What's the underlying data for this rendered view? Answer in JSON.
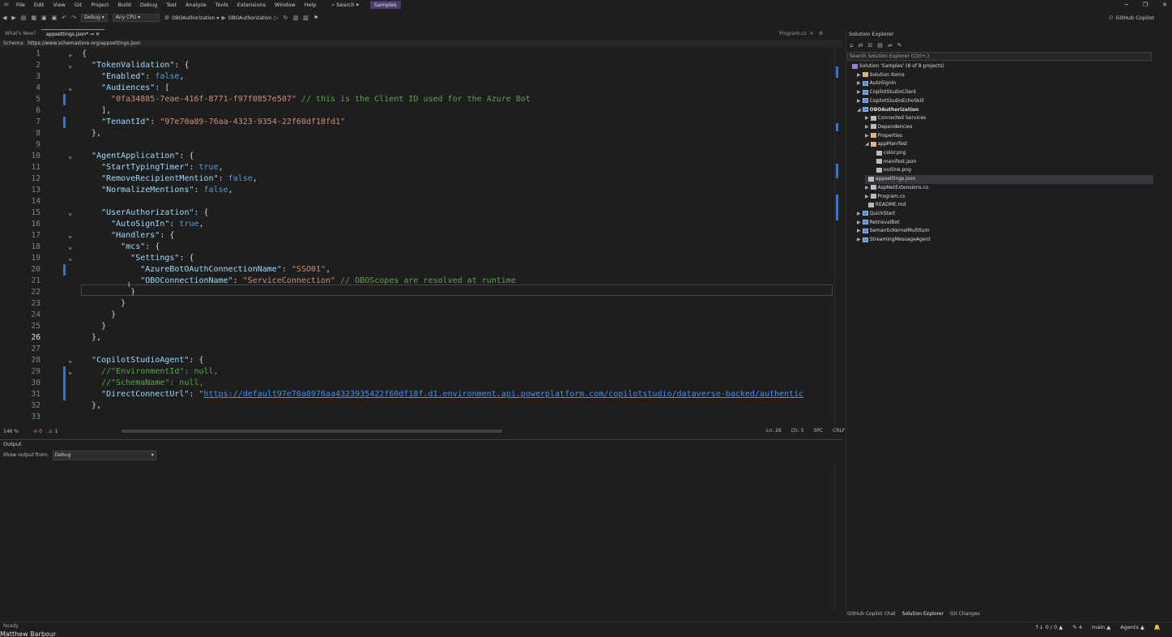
{
  "menu": [
    "File",
    "Edit",
    "View",
    "Git",
    "Project",
    "Build",
    "Debug",
    "Test",
    "Analyze",
    "Tools",
    "Extensions",
    "Window",
    "Help"
  ],
  "search_label": "Search",
  "solution_name": "Samples",
  "toolbar": {
    "config": "Debug",
    "platform": "Any CPU",
    "startup_project": "OBOAuthorization",
    "run_target": "OBOAuthorization",
    "github_copilot": "GitHub Copilot"
  },
  "tabs": {
    "whats_new": "What's New?",
    "active": "appsettings.json*",
    "program": "Program.cs"
  },
  "schema": {
    "label": "Schema:",
    "url": "https://www.schemastore.org/appsettings.json"
  },
  "code_lines": [
    {
      "n": "1",
      "fold": "v",
      "mark": false,
      "html": "<span class='p'>{</span>"
    },
    {
      "n": "2",
      "fold": "v",
      "mark": false,
      "html": "  <span class='k'>\"TokenValidation\"</span><span class='p'>: {</span>"
    },
    {
      "n": "3",
      "fold": "",
      "mark": false,
      "html": "    <span class='k'>\"Enabled\"</span><span class='p'>: </span><span class='b'>false</span><span class='p'>,</span>"
    },
    {
      "n": "4",
      "fold": "v",
      "mark": false,
      "html": "    <span class='k'>\"Audiences\"</span><span class='p'>: [</span>"
    },
    {
      "n": "5",
      "fold": "",
      "mark": true,
      "html": "      <span class='s'>\"0fa34885-7eae-416f-8771-f97f0857e507\"</span> <span class='c'>// this is the Client ID used for the Azure Bot</span>"
    },
    {
      "n": "6",
      "fold": "",
      "mark": false,
      "html": "    <span class='p'>],</span>"
    },
    {
      "n": "7",
      "fold": "",
      "mark": true,
      "html": "    <span class='k'>\"TenantId\"</span><span class='p'>: </span><span class='s'>\"97e70a89-76aa-4323-9354-22f60df18fd1\"</span>"
    },
    {
      "n": "8",
      "fold": "",
      "mark": false,
      "html": "  <span class='p'>},</span>"
    },
    {
      "n": "9",
      "fold": "",
      "mark": false,
      "html": ""
    },
    {
      "n": "10",
      "fold": "v",
      "mark": false,
      "html": "  <span class='k'>\"AgentApplication\"</span><span class='p'>: {</span>"
    },
    {
      "n": "11",
      "fold": "",
      "mark": false,
      "html": "    <span class='k'>\"StartTypingTimer\"</span><span class='p'>: </span><span class='b'>true</span><span class='p'>,</span>"
    },
    {
      "n": "12",
      "fold": "",
      "mark": false,
      "html": "    <span class='k'>\"RemoveRecipientMention\"</span><span class='p'>: </span><span class='b'>false</span><span class='p'>,</span>"
    },
    {
      "n": "13",
      "fold": "",
      "mark": false,
      "html": "    <span class='k'>\"NormalizeMentions\"</span><span class='p'>: </span><span class='b'>false</span><span class='p'>,</span>"
    },
    {
      "n": "14",
      "fold": "",
      "mark": false,
      "html": ""
    },
    {
      "n": "15",
      "fold": "v",
      "mark": false,
      "html": "    <span class='k'>\"UserAuthorization\"</span><span class='p'>: {</span>"
    },
    {
      "n": "16",
      "fold": "",
      "mark": false,
      "html": "      <span class='k'>\"AutoSignIn\"</span><span class='p'>: </span><span class='b'>true</span><span class='p'>,</span>"
    },
    {
      "n": "17",
      "fold": "v",
      "mark": false,
      "html": "      <span class='k'>\"Handlers\"</span><span class='p'>: {</span>"
    },
    {
      "n": "18",
      "fold": "v",
      "mark": false,
      "html": "        <span class='k'>\"mcs\"</span><span class='p'>: {</span>"
    },
    {
      "n": "19",
      "fold": "v",
      "mark": false,
      "html": "          <span class='k'>\"Settings\"</span><span class='p'>: {</span>"
    },
    {
      "n": "20",
      "fold": "",
      "mark": true,
      "html": "            <span class='k'>\"AzureBotOAuthConnectionName\"</span><span class='p'>: </span><span class='s'>\"SSO01\"</span><span class='p'>,</span>"
    },
    {
      "n": "21",
      "fold": "",
      "mark": false,
      "html": "            <span class='k'>\"OBOConnectionName\"</span><span class='p'>: </span><span class='s'>\"ServiceConnection\"</span> <span class='c'>// OBOScopes are resolved at runtime</span>"
    },
    {
      "n": "22",
      "fold": "",
      "mark": false,
      "html": "          <span class='p'>}</span>"
    },
    {
      "n": "23",
      "fold": "",
      "mark": false,
      "html": "        <span class='p'>}</span>"
    },
    {
      "n": "24",
      "fold": "",
      "mark": false,
      "html": "      <span class='p'>}</span>"
    },
    {
      "n": "25",
      "fold": "",
      "mark": false,
      "html": "    <span class='p'>}</span>"
    },
    {
      "n": "26",
      "fold": "",
      "mark": false,
      "html": "  <span class='p'>},</span>"
    },
    {
      "n": "27",
      "fold": "",
      "mark": false,
      "html": ""
    },
    {
      "n": "28",
      "fold": "v",
      "mark": false,
      "html": "  <span class='k'>\"CopilotStudioAgent\"</span><span class='p'>: {</span>"
    },
    {
      "n": "29",
      "fold": "v",
      "mark": true,
      "html": "    <span class='c'>//\"EnvironmentId\": null,</span>"
    },
    {
      "n": "30",
      "fold": "",
      "mark": true,
      "html": "    <span class='c'>//\"SchemaName\": null,</span>"
    },
    {
      "n": "31",
      "fold": "",
      "mark": true,
      "html": "    <span class='k'>\"DirectConnectUrl\"</span><span class='p'>: </span><span class='s'>\"</span><span class='lnk'>https://default97e70a8976aa4323935422f60df18f.d1.environment.api.powerplatform.com/copilotstudio/dataverse-backed/authentic</span>"
    },
    {
      "n": "32",
      "fold": "",
      "mark": false,
      "html": "  <span class='p'>},</span>"
    },
    {
      "n": "33",
      "fold": "",
      "mark": false,
      "html": ""
    }
  ],
  "current_line": "26",
  "editor_status": {
    "zoom": "146 %",
    "errors": "0",
    "warnings": "1",
    "line": "Ln: 26",
    "col": "Ch: 5",
    "spc": "SPC",
    "eol": "CRLF"
  },
  "output": {
    "title": "Output",
    "show_from_label": "Show output from:",
    "source": "Debug"
  },
  "solution_explorer": {
    "title": "Solution Explorer",
    "search_placeholder": "Search Solution Explorer (Ctrl+;)",
    "tree": [
      {
        "label": "Solution 'Samples' (8 of 8 projects)",
        "depth": 0,
        "icon": "sol",
        "arrow": ""
      },
      {
        "label": "Solution Items",
        "depth": 1,
        "icon": "folder",
        "arrow": "▶"
      },
      {
        "label": "AutoSignIn",
        "depth": 1,
        "icon": "proj",
        "arrow": "▶"
      },
      {
        "label": "CopilotStudioClient",
        "depth": 1,
        "icon": "proj",
        "arrow": "▶"
      },
      {
        "label": "CopilotStudioEchoSkill",
        "depth": 1,
        "icon": "proj",
        "arrow": "▶"
      },
      {
        "label": "OBOAuthorization",
        "depth": 1,
        "icon": "proj",
        "arrow": "◢",
        "bold": true
      },
      {
        "label": "Connected Services",
        "depth": 2,
        "icon": "file",
        "arrow": "▶"
      },
      {
        "label": "Dependencies",
        "depth": 2,
        "icon": "file",
        "arrow": "▶"
      },
      {
        "label": "Properties",
        "depth": 2,
        "icon": "folder",
        "arrow": "▶"
      },
      {
        "label": "appManifest",
        "depth": 2,
        "icon": "folder",
        "arrow": "◢"
      },
      {
        "label": "color.png",
        "depth": 3,
        "icon": "file",
        "arrow": ""
      },
      {
        "label": "manifest.json",
        "depth": 3,
        "icon": "file",
        "arrow": ""
      },
      {
        "label": "outline.png",
        "depth": 3,
        "icon": "file",
        "arrow": ""
      },
      {
        "label": "appsettings.json",
        "depth": 2,
        "icon": "file",
        "arrow": "",
        "sel": true
      },
      {
        "label": "AspNetExtensions.cs",
        "depth": 2,
        "icon": "file",
        "arrow": "▶"
      },
      {
        "label": "Program.cs",
        "depth": 2,
        "icon": "file",
        "arrow": "▶"
      },
      {
        "label": "README.md",
        "depth": 2,
        "icon": "file",
        "arrow": ""
      },
      {
        "label": "QuickStart",
        "depth": 1,
        "icon": "proj",
        "arrow": "▶"
      },
      {
        "label": "RetrievalBot",
        "depth": 1,
        "icon": "proj",
        "arrow": "▶"
      },
      {
        "label": "SemanticKernelMultiturn",
        "depth": 1,
        "icon": "proj",
        "arrow": "▶"
      },
      {
        "label": "StreamingMessageAgent",
        "depth": 1,
        "icon": "proj",
        "arrow": "▶"
      }
    ],
    "bottom_tabs": [
      "GitHub Copilot Chat",
      "Solution Explorer",
      "Git Changes"
    ]
  },
  "statusbar": {
    "ready": "Ready",
    "sync": "↑↓ 0 / 0 ▲",
    "edits": "✎ 4",
    "branch": "main ▲",
    "agents": "Agents ▲",
    "user": "Matthew Barbour"
  },
  "colors": {
    "accent": "#9b7fd4",
    "change_bar": "#3a75c4"
  }
}
